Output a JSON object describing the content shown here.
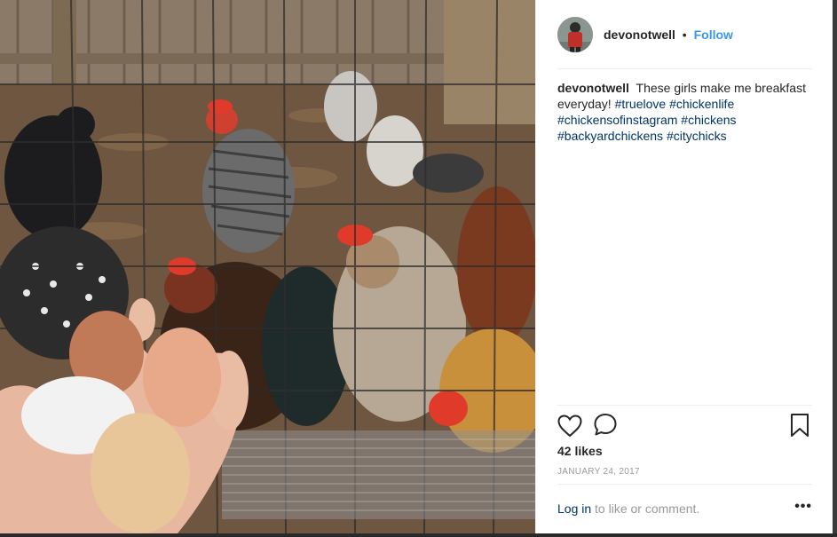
{
  "post": {
    "username": "devonotwell",
    "separator": "•",
    "follow_label": "Follow",
    "caption_text": "These girls make me breakfast everyday!",
    "hashtags": [
      "#truelove",
      "#chickenlife",
      "#chickensofinstagram",
      "#chickens",
      "#backyardchickens",
      "#citychicks"
    ],
    "likes": "42 likes",
    "date": "JANUARY 24, 2017",
    "login_link": "Log in",
    "login_rest": "to like or comment.",
    "more_label": "•••"
  },
  "icons": {
    "like": "heart-outline-icon",
    "comment": "speech-bubble-icon",
    "save": "bookmark-icon",
    "more": "ellipsis-icon"
  },
  "colors": {
    "follow": "#3897f0",
    "hashtag": "#003569",
    "muted": "#999999",
    "text": "#262626"
  }
}
